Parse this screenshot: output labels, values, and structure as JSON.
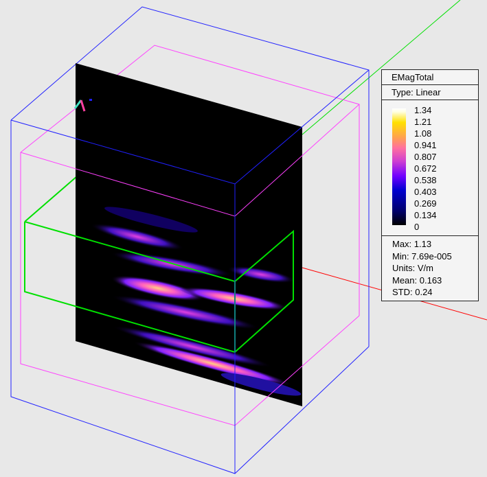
{
  "legend": {
    "title": "EMagTotal",
    "type": "Type: Linear",
    "ticks": [
      "1.34",
      "1.21",
      "1.08",
      "0.941",
      "0.807",
      "0.672",
      "0.538",
      "0.403",
      "0.269",
      "0.134",
      "0"
    ],
    "stats": {
      "max": "Max: 1.13",
      "min": "Min: 7.69e-005",
      "units": "Units: V/m",
      "mean": "Mean: 0.163",
      "std": "STD: 0.24"
    }
  },
  "colors": {
    "background": "#e8e8e8",
    "outer_box": "#2020ff",
    "inner_box": "#ff40ff",
    "object_box": "#00e000",
    "axis_x": "#ff0000",
    "axis_y": "#00e000"
  }
}
